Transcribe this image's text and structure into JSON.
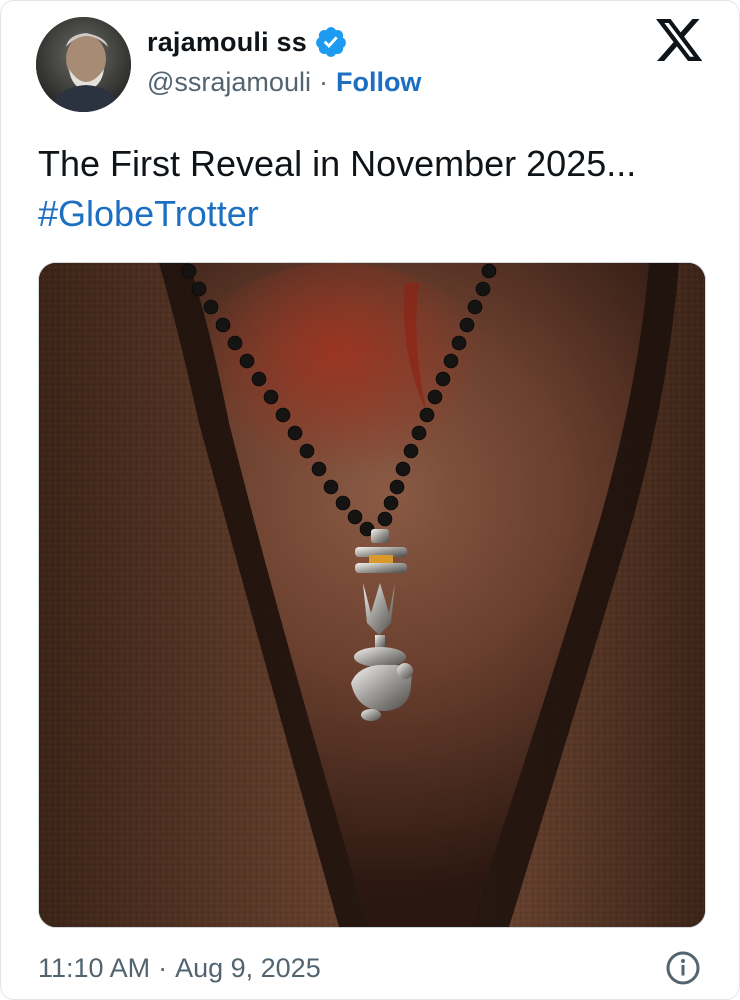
{
  "author": {
    "display_name": "rajamouli ss",
    "handle": "@ssrajamouli",
    "separator": "·",
    "follow_label": "Follow",
    "verified_icon": "verified-badge-icon",
    "verified_color": "#1d9bf0"
  },
  "platform": {
    "logo_icon": "x-logo-icon"
  },
  "tweet": {
    "text": "The First Reveal in November 2025...",
    "hashtag": "#GlobeTrotter",
    "link_color": "#1d6fc2"
  },
  "media": {
    "kind": "photo",
    "subject": "bead necklace with trident and nandi pendant"
  },
  "footer": {
    "time": "11:10 AM",
    "separator": "·",
    "date": "Aug 9, 2025",
    "info_icon": "info-icon"
  }
}
